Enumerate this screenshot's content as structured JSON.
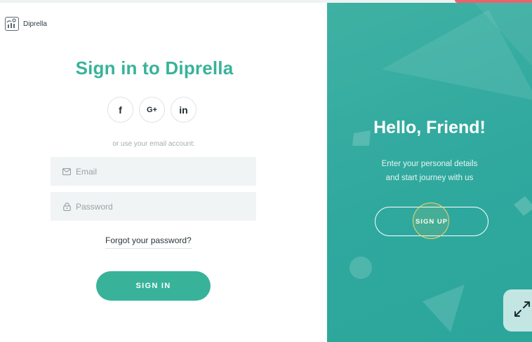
{
  "brand": {
    "name": "Diprella",
    "logo_icon": "brand-logo-icon"
  },
  "left": {
    "title": "Sign in to Diprella",
    "socials": [
      {
        "label": "f",
        "icon": "facebook-icon"
      },
      {
        "label": "G+",
        "icon": "google-plus-icon"
      },
      {
        "label": "in",
        "icon": "linkedin-icon"
      }
    ],
    "or_text": "or use your email account:",
    "email": {
      "placeholder": "Email",
      "icon": "mail-icon"
    },
    "password": {
      "placeholder": "Password",
      "icon": "lock-icon"
    },
    "forgot_label": "Forgot your password?",
    "signin_label": "SIGN IN"
  },
  "right": {
    "title": "Hello, Friend!",
    "subtitle_line1": "Enter your personal details",
    "subtitle_line2": "and start journey with us",
    "signup_label": "SIGN UP",
    "background_color": "#31aa9f"
  },
  "colors": {
    "accent": "#38b39a",
    "corner": "#e8636b"
  },
  "expand_button": {
    "icon": "expand-icon"
  }
}
